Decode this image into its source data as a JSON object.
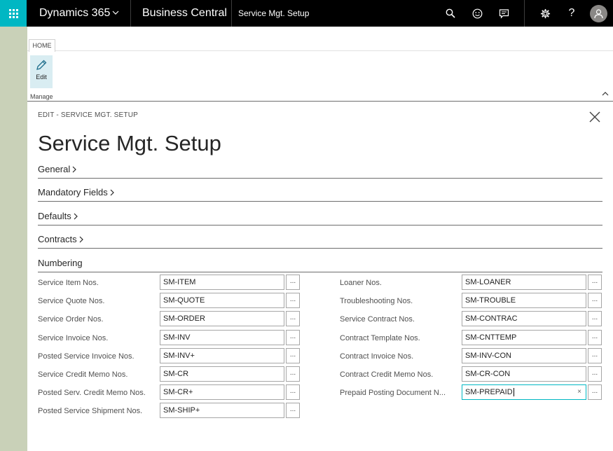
{
  "topbar": {
    "brand": "Dynamics 365",
    "product": "Business Central",
    "page_name": "Service Mgt. Setup",
    "icons": [
      "search-icon",
      "smiley-icon",
      "chat-icon",
      "gear-icon",
      "help-icon",
      "user-avatar-icon"
    ]
  },
  "ribbon": {
    "tab_label": "HOME",
    "edit_label": "Edit",
    "group_label": "Manage"
  },
  "header": {
    "breadcrumb": "EDIT - SERVICE MGT. SETUP",
    "title": "Service Mgt. Setup"
  },
  "fasttabs": [
    "General",
    "Mandatory Fields",
    "Defaults",
    "Contracts"
  ],
  "numbering": {
    "label": "Numbering",
    "left": [
      {
        "label": "Service Item Nos.",
        "value": "SM-ITEM"
      },
      {
        "label": "Service Quote Nos.",
        "value": "SM-QUOTE"
      },
      {
        "label": "Service Order Nos.",
        "value": "SM-ORDER"
      },
      {
        "label": "Service Invoice Nos.",
        "value": "SM-INV"
      },
      {
        "label": "Posted Service Invoice Nos.",
        "value": "SM-INV+"
      },
      {
        "label": "Service Credit Memo Nos.",
        "value": "SM-CR"
      },
      {
        "label": "Posted Serv. Credit Memo Nos.",
        "value": "SM-CR+"
      },
      {
        "label": "Posted Service Shipment Nos.",
        "value": "SM-SHIP+"
      }
    ],
    "right": [
      {
        "label": "Loaner Nos.",
        "value": "SM-LOANER"
      },
      {
        "label": "Troubleshooting Nos.",
        "value": "SM-TROUBLE"
      },
      {
        "label": "Service Contract Nos.",
        "value": "SM-CONTRAC"
      },
      {
        "label": "Contract Template Nos.",
        "value": "SM-CNTTEMP"
      },
      {
        "label": "Contract Invoice Nos.",
        "value": "SM-INV-CON"
      },
      {
        "label": "Contract Credit Memo Nos.",
        "value": "SM-CR-CON"
      },
      {
        "label": "Prepaid Posting Document N...",
        "value": "SM-PREPAID"
      }
    ],
    "assist_label": "...",
    "clear_label": "×"
  },
  "colors": {
    "accent": "#00b7c3",
    "topbar_bg": "#000000",
    "edit_button_bg": "#d9edf2"
  }
}
